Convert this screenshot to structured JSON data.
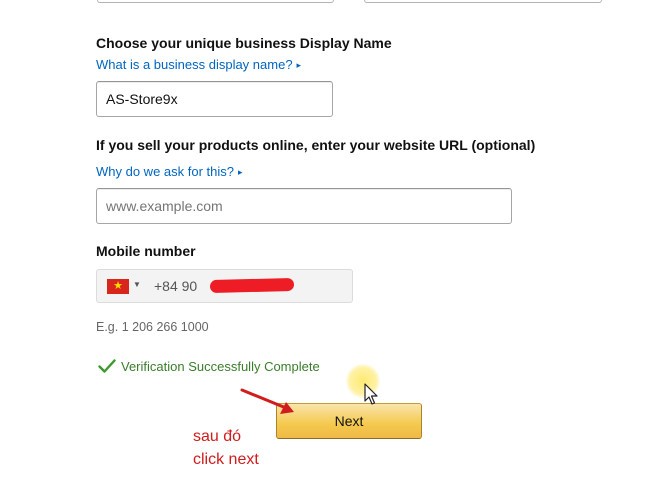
{
  "display_name": {
    "label": "Choose your unique business Display Name",
    "help_link": "What is a business display name?",
    "value": "AS-Store9x"
  },
  "website": {
    "label": "If you sell your products online, enter your website URL (optional)",
    "help_link": "Why do we ask for this?",
    "placeholder": "www.example.com"
  },
  "mobile": {
    "label": "Mobile number",
    "country_flag": "vietnam-flag",
    "prefix": "+84 90",
    "example": "E.g. 1 206 266 1000",
    "verification_status": "Verification Successfully Complete"
  },
  "next_button": {
    "label": "Next"
  },
  "annotation": {
    "line1": "sau đó",
    "line2": "click next"
  },
  "colors": {
    "link": "#0066c0",
    "success": "#3a7d2b",
    "button": "#f0c14b",
    "annotation": "#d01c1c"
  }
}
